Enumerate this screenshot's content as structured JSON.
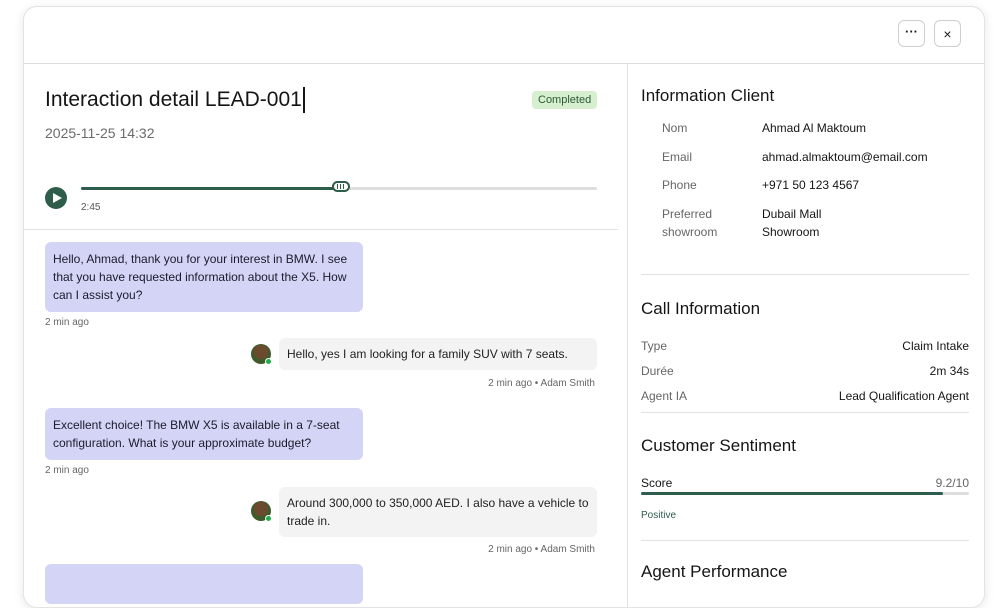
{
  "toolbar": {
    "more_label": "···",
    "close_label": "×"
  },
  "interaction": {
    "title": "Interaction detail LEAD-001",
    "status": "Completed",
    "datetime": "2025-11-25 14:32"
  },
  "player": {
    "current_time": "2:45",
    "progress_fraction": 0.503
  },
  "messages": [
    {
      "role": "agent",
      "text": "Hello, Ahmad, thank you for your interest in BMW. I see that you have requested information about the X5. How can I assist you?",
      "meta": "2 min ago"
    },
    {
      "role": "user",
      "text": "Hello, yes I am looking for a family SUV with 7 seats.",
      "meta": "2 min ago • Adam Smith"
    },
    {
      "role": "agent",
      "text": "Excellent choice! The BMW X5 is available in a 7-seat configuration. What is your approximate budget?",
      "meta": "2 min ago"
    },
    {
      "role": "user",
      "text": "Around 300,000 to 350,000 AED. I also have a vehicle to trade in.",
      "meta": "2 min ago • Adam Smith"
    }
  ],
  "client": {
    "heading": "Information Client",
    "fields": [
      {
        "label": "Nom",
        "value": "Ahmad Al Maktoum"
      },
      {
        "label": "Email",
        "value": "ahmad.almaktoum@email.com"
      },
      {
        "label": "Phone",
        "value": "+971 50 123 4567"
      },
      {
        "label": "Preferred showroom",
        "value": "Dubail Mall Showroom"
      }
    ]
  },
  "call": {
    "heading": "Call Information",
    "fields": [
      {
        "label": "Type",
        "value": "Claim Intake"
      },
      {
        "label": "Durée",
        "value": "2m 34s"
      },
      {
        "label": "Agent IA",
        "value": "Lead Qualification Agent"
      }
    ]
  },
  "sentiment": {
    "heading": "Customer Sentiment",
    "score_label": "Score",
    "score_value": "9.2/10",
    "score_fraction": 0.92,
    "label": "Positive"
  },
  "performance": {
    "heading": "Agent Performance"
  },
  "colors": {
    "accent": "#2f5d4c",
    "agent_bubble": "#d4d4f6",
    "badge_bg": "#d6efcf"
  }
}
